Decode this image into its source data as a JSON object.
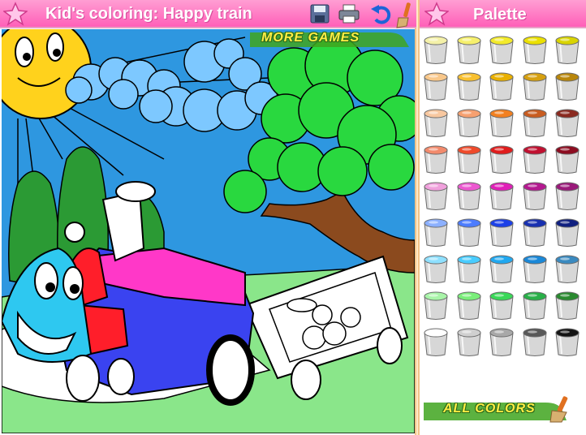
{
  "header": {
    "title": "Kid's coloring: Happy train",
    "icons": [
      "star-icon",
      "save-icon",
      "print-icon",
      "undo-icon",
      "brush-icon"
    ]
  },
  "more_games": {
    "label": "MORE GAMES"
  },
  "palette": {
    "title": "Palette",
    "colors": [
      [
        "#f4f1a8",
        "#f6f06c",
        "#f3ea2a",
        "#ebe000",
        "#d9d400"
      ],
      [
        "#f8c78a",
        "#f8c030",
        "#e9b000",
        "#d6a010",
        "#b8860b"
      ],
      [
        "#f8c8a0",
        "#f6a070",
        "#f28020",
        "#c85c20",
        "#8a2a20"
      ],
      [
        "#f28a6c",
        "#ef4a2a",
        "#e01c1c",
        "#c01030",
        "#8c0c20"
      ],
      [
        "#f0a0dc",
        "#ec58d0",
        "#e020b8",
        "#b41890",
        "#9a1a7a"
      ],
      [
        "#8cb0ff",
        "#4c7cff",
        "#1c40e8",
        "#1830b0",
        "#102080"
      ],
      [
        "#8ee0ff",
        "#48ccff",
        "#20a8f0",
        "#1a88d8",
        "#3a8ac0"
      ],
      [
        "#a8f4a8",
        "#7aee7a",
        "#3ad858",
        "#28b048",
        "#2a8a30"
      ],
      [
        "#ffffff",
        "#d0d0d0",
        "#a8a8a8",
        "#585858",
        "#141414"
      ]
    ]
  },
  "all_colors": {
    "label": "ALL COLORS"
  },
  "scene_colors": {
    "sky": "#2e97e0",
    "sun": "#ffd21c",
    "cloud": "#7dc8ff",
    "tree": "#29d83f",
    "bush": "#2b9a34",
    "ground": "#8ae68a",
    "road": "#ffffff",
    "trunk": "#8b4a1e",
    "train_body": "#3a43f0",
    "train_roof": "#ff38c8",
    "train_red": "#ff1e2a",
    "train_face": "#2ec8f0"
  }
}
